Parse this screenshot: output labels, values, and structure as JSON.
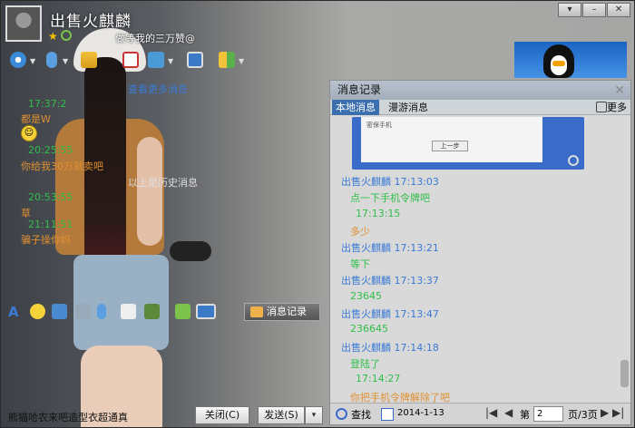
{
  "window": {
    "nickname": "出售火麒麟",
    "signature": "做等我的三万赞@"
  },
  "title_bar": {
    "min_label": "–",
    "menu_label": "▾",
    "close_label": "✕"
  },
  "chat_left": {
    "messages": [
      {
        "text": "17:37:2",
        "kind": "time"
      },
      {
        "text": "都是W",
        "kind": "text"
      },
      {
        "text": "20:25:55",
        "kind": "time"
      },
      {
        "text": "你给我30万就卖吧",
        "kind": "text"
      },
      {
        "text": "20:53:55",
        "kind": "time"
      },
      {
        "text": "草",
        "kind": "text"
      },
      {
        "text": "21:11:51",
        "kind": "time"
      },
      {
        "text": "骗子操你妈",
        "kind": "text"
      }
    ],
    "more_link": "查看更多消息",
    "history_hint": "以上是历史消息"
  },
  "input_box": {
    "text": "熊猫哈农来吧造型衣超通真"
  },
  "buttons": {
    "message_record": "消息记录",
    "close": "关闭(C)",
    "send": "发送(S)",
    "send_dropdown": "▾"
  },
  "panel": {
    "title": "消息记录",
    "close_label": "✕",
    "tabs": {
      "local": "本地消息",
      "roam": "漫游消息"
    },
    "more": "更多",
    "thumb": {
      "text": "密保手机",
      "button": "上一步"
    },
    "records": [
      {
        "text": "出售火麒麟 17:13:03",
        "kind": "header"
      },
      {
        "text": "点一下手机令牌吧",
        "kind": "green"
      },
      {
        "text": "17:13:15",
        "kind": "green"
      },
      {
        "text": "多少",
        "kind": "orange"
      },
      {
        "text": "出售火麒麟 17:13:21",
        "kind": "header"
      },
      {
        "text": "等下",
        "kind": "green"
      },
      {
        "text": "出售火麒麟 17:13:37",
        "kind": "header"
      },
      {
        "text": "23645",
        "kind": "green"
      },
      {
        "text": "出售火麒麟 17:13:47",
        "kind": "header"
      },
      {
        "text": "236645",
        "kind": "green"
      },
      {
        "text": "出售火麒麟 17:14:18",
        "kind": "header"
      },
      {
        "text": "登陆了",
        "kind": "green"
      },
      {
        "text": "17:14:27",
        "kind": "green"
      },
      {
        "text": "你把手机令牌解除了吧",
        "kind": "orange"
      }
    ],
    "footer": {
      "find": "查找",
      "date": "2014-1-13",
      "page_prefix": "第",
      "page_value": "2",
      "page_total": "页/3页",
      "nav_first": "|◀",
      "nav_prev": "◀",
      "nav_next": "▶",
      "nav_last": "▶|"
    }
  },
  "colors": {
    "time_green": "#2fbf4a",
    "text_orange": "#e09030",
    "header_blue": "#3a7ad6",
    "tab_active": "#3b6fae"
  }
}
